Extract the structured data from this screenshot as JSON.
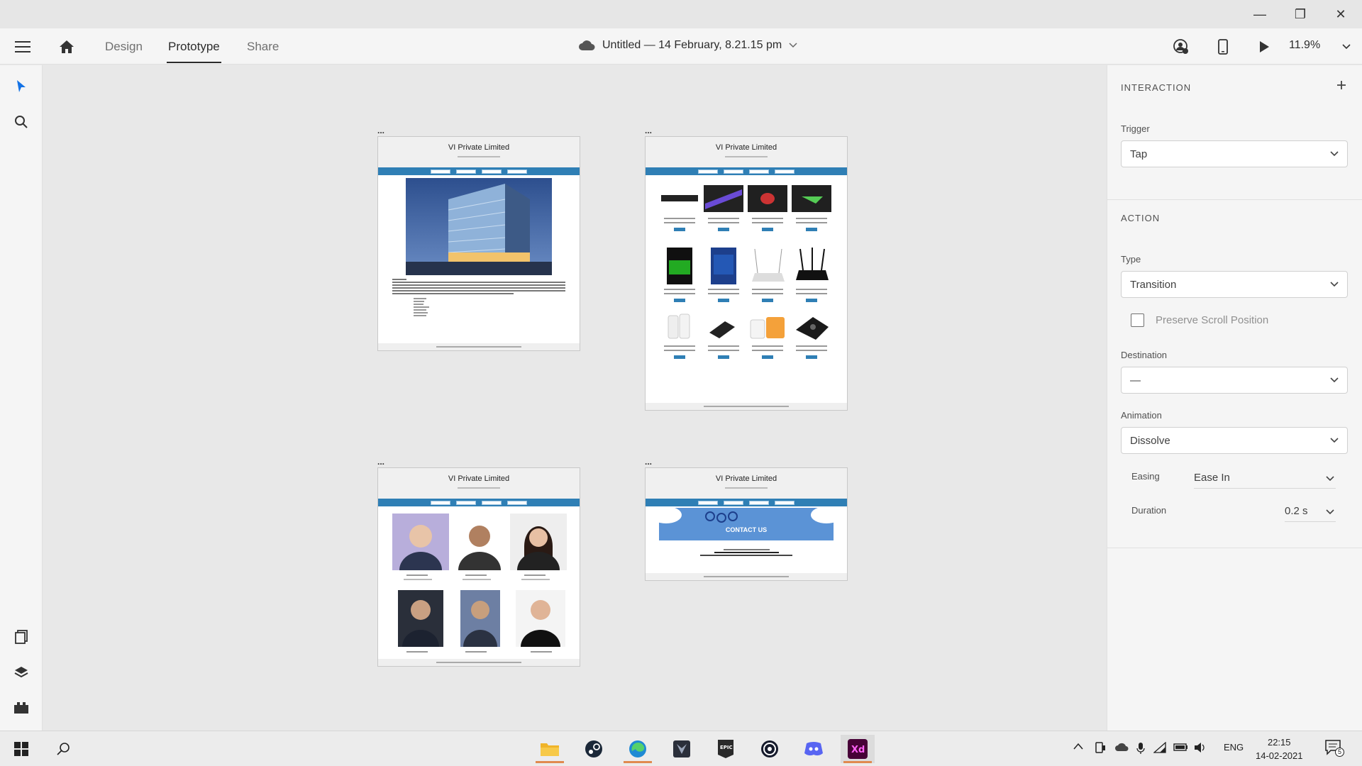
{
  "window": {
    "minimize": "—",
    "restore": "❐",
    "close": "✕"
  },
  "header": {
    "tabs": [
      {
        "label": "Design"
      },
      {
        "label": "Prototype"
      },
      {
        "label": "Share"
      }
    ],
    "document_title": "Untitled — 14 February, 8.21.15 pm",
    "zoom": "11.9%"
  },
  "artboards": [
    {
      "dots": "...",
      "title": "VI Private Limited"
    },
    {
      "dots": "...",
      "title": "VI Private Limited"
    },
    {
      "dots": "...",
      "title": "VI Private Limited"
    },
    {
      "dots": "...",
      "title": "VI Private Limited"
    }
  ],
  "contact_banner": "CONTACT US",
  "panel": {
    "interaction_title": "INTERACTION",
    "trigger_label": "Trigger",
    "trigger_value": "Tap",
    "action_title": "ACTION",
    "type_label": "Type",
    "type_value": "Transition",
    "preserve_label": "Preserve Scroll Position",
    "destination_label": "Destination",
    "destination_value": "—",
    "animation_label": "Animation",
    "animation_value": "Dissolve",
    "easing_label": "Easing",
    "easing_value": "Ease In",
    "duration_label": "Duration",
    "duration_value": "0.2 s"
  },
  "taskbar": {
    "lang": "ENG",
    "time": "22:15",
    "date": "14-02-2021",
    "notifications": "5"
  },
  "colors": {
    "nav_blue": "#2f7fb5",
    "xd_purple": "#470137",
    "xd_pink": "#ff61f6"
  }
}
